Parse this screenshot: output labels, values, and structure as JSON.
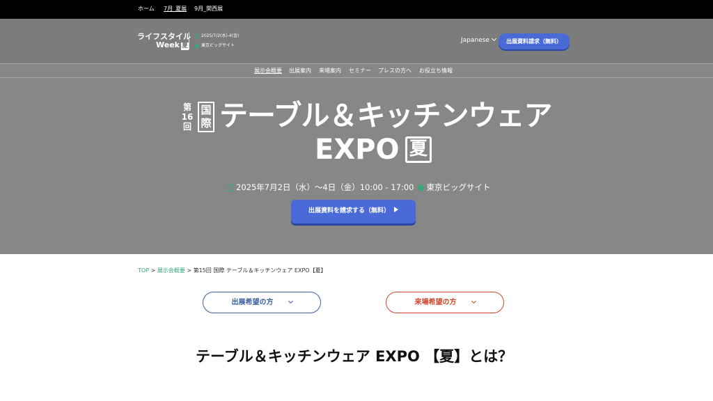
{
  "topnav": {
    "items": [
      {
        "label": "ホーム",
        "active": false
      },
      {
        "label": "7月_夏展",
        "active": true
      },
      {
        "label": "9月_関西展",
        "active": false
      }
    ]
  },
  "header": {
    "logo_line1": "ライフスタイル",
    "logo_line2": "Week",
    "logo_badge": "夏",
    "event_date": "2025/7/2(水)-4(金)",
    "event_venue": "東京ビッグサイト",
    "language": "Japanese",
    "request_button": "出展資料請求（無料）"
  },
  "nav": {
    "items": [
      {
        "label": "展示会概要",
        "active": true
      },
      {
        "label": "出展案内",
        "active": false
      },
      {
        "label": "来場案内",
        "active": false
      },
      {
        "label": "セミナー",
        "active": false
      },
      {
        "label": "プレスの方へ",
        "active": false
      },
      {
        "label": "お役立ち情報",
        "active": false
      }
    ]
  },
  "hero": {
    "edition_prefix": "第",
    "edition_number": "16",
    "edition_suffix": "回",
    "intl_badge_1": "国",
    "intl_badge_2": "際",
    "title_line1": "テーブル＆キッチンウェア",
    "title_line2": "EXPO",
    "season_badge": "夏",
    "date_text": "2025年7月2日（水）～4日（金）10:00 - 17:00",
    "venue_text": "東京ビッグサイト",
    "cta_label": "出展資料を請求する（無料）"
  },
  "breadcrumb": {
    "items": [
      "TOP",
      "展示会概要"
    ],
    "separator": " > ",
    "current": "第15回 国際 テーブル＆キッチンウェア EXPO【夏】"
  },
  "audience": {
    "exhibitor_label": "出展希望の方",
    "visitor_label": "来場希望の方"
  },
  "section": {
    "title": "テーブル＆キッチンウェア EXPO 【夏】とは？"
  },
  "colors": {
    "primary_button": "#4a6ad8",
    "accent_green": "#3aa87a",
    "exhibitor_blue": "#3d5f9e",
    "visitor_red": "#d0452a",
    "hero_grey": "#878787"
  }
}
